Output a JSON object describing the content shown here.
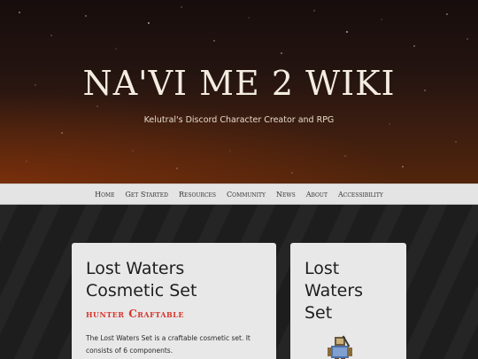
{
  "site": {
    "title": "NA'VI ME 2 WIKI",
    "subtitle": "Kelutral's Discord Character Creator and RPG"
  },
  "nav": {
    "items": [
      {
        "label": "Home"
      },
      {
        "label": "Get Started"
      },
      {
        "label": "Resources"
      },
      {
        "label": "Community"
      },
      {
        "label": "News"
      },
      {
        "label": "About"
      },
      {
        "label": "Accessibility"
      }
    ]
  },
  "main_card": {
    "title_line1": "Lost Waters",
    "title_line2": "Cosmetic Set",
    "badge": "hunter Craftable",
    "desc_line1": "The Lost Waters Set is a craftable cosmetic set. It",
    "desc_line2": "consists of 6 components."
  },
  "side_card": {
    "title_line1": "Lost",
    "title_line2": "Waters",
    "title_line3": "Set",
    "thumbnail_icon": "armor-set-sprite-icon"
  },
  "colors": {
    "accent_red": "#d8342b",
    "nav_bg": "#e4e4e4",
    "card_bg": "#e8e8e8"
  }
}
